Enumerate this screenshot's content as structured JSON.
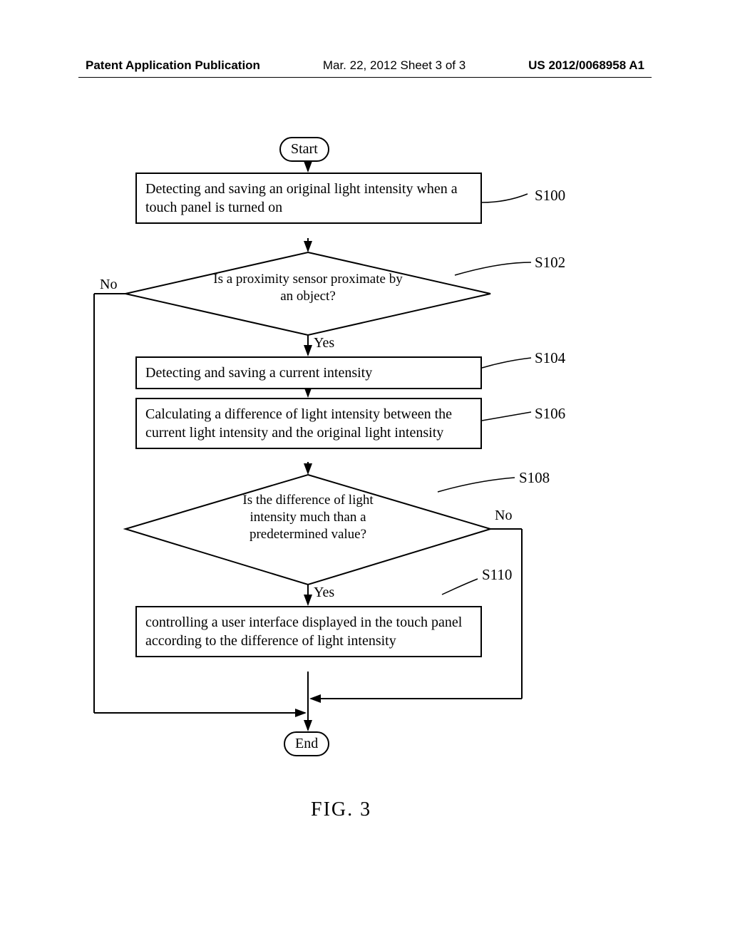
{
  "header": {
    "left": "Patent Application Publication",
    "center": "Mar. 22, 2012  Sheet 3 of 3",
    "right": "US 2012/0068958 A1"
  },
  "flow": {
    "start": "Start",
    "s100": "Detecting and saving an original light intensity  when a touch panel is turned on",
    "s102": "Is a proximity sensor proximate by an object?",
    "s104": "Detecting and saving a current intensity",
    "s106": "Calculating a difference of light intensity between the current light intensity and the original light intensity",
    "s108": "Is the difference of light intensity much than a predetermined value?",
    "s110": "controlling a user interface displayed in the touch panel according to the difference of light intensity",
    "end": "End",
    "yes": "Yes",
    "no": "No"
  },
  "step_labels": {
    "s100": "S100",
    "s102": "S102",
    "s104": "S104",
    "s106": "S106",
    "s108": "S108",
    "s110": "S110"
  },
  "figure": "FIG. 3",
  "chart_data": {
    "type": "flowchart",
    "nodes": [
      {
        "id": "start",
        "type": "terminator",
        "label": "Start"
      },
      {
        "id": "S100",
        "type": "process",
        "label": "Detecting and saving an original light intensity when a touch panel is turned on"
      },
      {
        "id": "S102",
        "type": "decision",
        "label": "Is a proximity sensor proximate by an object?"
      },
      {
        "id": "S104",
        "type": "process",
        "label": "Detecting and saving a current intensity"
      },
      {
        "id": "S106",
        "type": "process",
        "label": "Calculating a difference of light intensity between the current light intensity and the original light intensity"
      },
      {
        "id": "S108",
        "type": "decision",
        "label": "Is the difference of light intensity much than a predetermined value?"
      },
      {
        "id": "S110",
        "type": "process",
        "label": "controlling a user interface displayed in the touch panel according to the difference of light intensity"
      },
      {
        "id": "end",
        "type": "terminator",
        "label": "End"
      }
    ],
    "edges": [
      {
        "from": "start",
        "to": "S100"
      },
      {
        "from": "S100",
        "to": "S102"
      },
      {
        "from": "S102",
        "to": "S104",
        "label": "Yes"
      },
      {
        "from": "S102",
        "to": "end",
        "label": "No"
      },
      {
        "from": "S104",
        "to": "S106"
      },
      {
        "from": "S106",
        "to": "S108"
      },
      {
        "from": "S108",
        "to": "S110",
        "label": "Yes"
      },
      {
        "from": "S108",
        "to": "end",
        "label": "No"
      },
      {
        "from": "S110",
        "to": "end"
      }
    ],
    "title": "FIG. 3"
  }
}
